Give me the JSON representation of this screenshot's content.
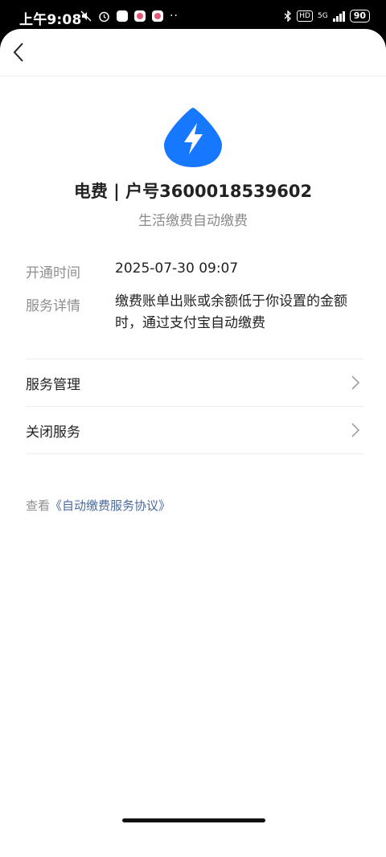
{
  "status_bar": {
    "time": "上午9:08",
    "hd_label": "HD",
    "network": "5G",
    "battery": "90"
  },
  "service": {
    "title": "电费 | 户号3600018539602",
    "subtitle": "生活缴费自动缴费",
    "open_time_label": "开通时间",
    "open_time_value": "2025-07-30 09:07",
    "detail_label": "服务详情",
    "detail_value": "缴费账单出账或余额低于你设置的金额时，通过支付宝自动缴费"
  },
  "menu": {
    "manage_label": "服务管理",
    "close_label": "关闭服务"
  },
  "agreement": {
    "prefix": "查看",
    "link": "《自动缴费服务协议》"
  },
  "colors": {
    "accent": "#1677ff",
    "link": "#4a6a9c"
  }
}
